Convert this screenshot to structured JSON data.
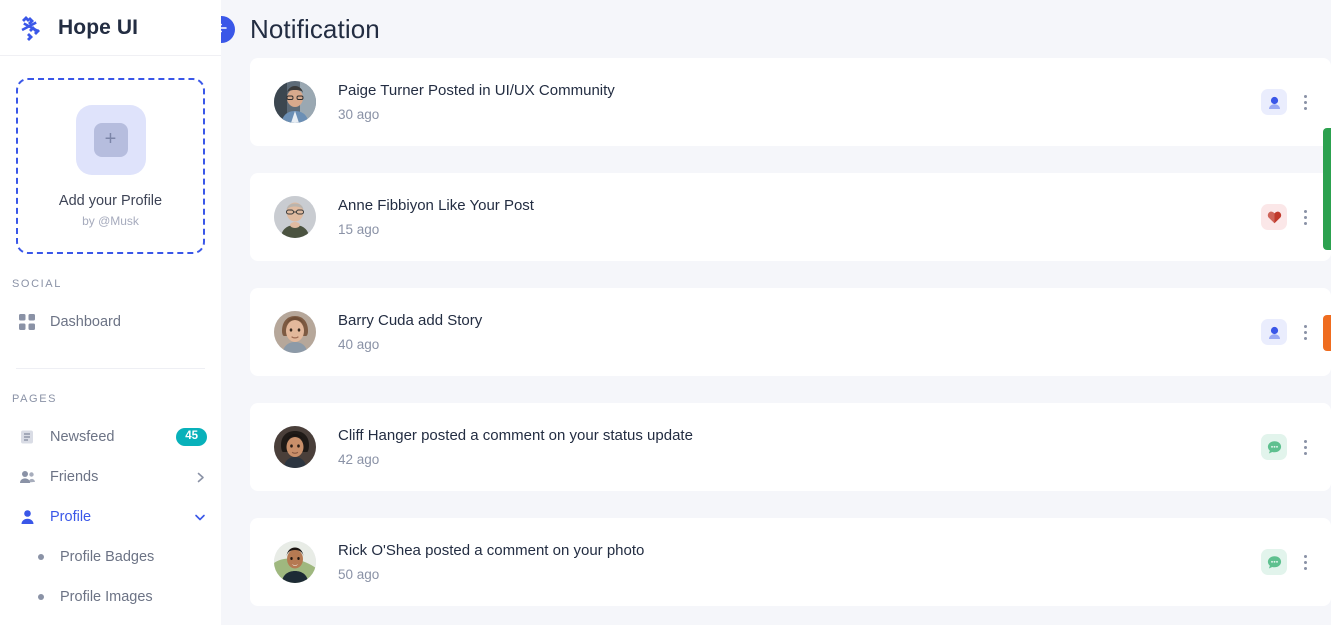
{
  "brand": {
    "name": "Hope UI",
    "logo_icon": "hope-ui-logo-icon"
  },
  "add_profile": {
    "plus_icon": "plus-icon",
    "title": "Add your Profile",
    "subtitle": "by @Musk"
  },
  "sidebar": {
    "sections": [
      {
        "label": "SOCIAL",
        "items": [
          {
            "label": "Dashboard",
            "icon": "grid-icon",
            "name": "sidebar-item-dashboard",
            "active": false,
            "badge": null,
            "chevron": null,
            "children": []
          }
        ]
      },
      {
        "label": "PAGES",
        "items": [
          {
            "label": "Newsfeed",
            "icon": "newsfeed-icon",
            "name": "sidebar-item-newsfeed",
            "active": false,
            "badge": "45",
            "chevron": null,
            "children": []
          },
          {
            "label": "Friends",
            "icon": "friends-icon",
            "name": "sidebar-item-friends",
            "active": false,
            "badge": null,
            "chevron": "chevron-right-icon",
            "children": []
          },
          {
            "label": "Profile",
            "icon": "user-icon",
            "name": "sidebar-item-profile",
            "active": true,
            "badge": null,
            "chevron": "chevron-down-icon",
            "children": [
              {
                "label": "Profile Badges",
                "name": "sidebar-subitem-profile-badges"
              },
              {
                "label": "Profile Images",
                "name": "sidebar-subitem-profile-images"
              }
            ]
          }
        ]
      }
    ]
  },
  "header": {
    "title": "Notification",
    "back_icon": "arrow-left-icon"
  },
  "notifications": [
    {
      "text": "Paige Turner Posted in UI/UX Community",
      "time": "30 ago",
      "avatar": "avatar-paige-turner",
      "action_icon": "user-badge-icon",
      "action_style": "blue",
      "menu_icon": "kebab-menu-icon"
    },
    {
      "text": "Anne Fibbiyon Like Your Post",
      "time": "15 ago",
      "avatar": "avatar-anne-fibbiyon",
      "action_icon": "heart-icon",
      "action_style": "pink",
      "menu_icon": "kebab-menu-icon"
    },
    {
      "text": "Barry Cuda add Story",
      "time": "40 ago",
      "avatar": "avatar-barry-cuda",
      "action_icon": "user-badge-icon",
      "action_style": "blue",
      "menu_icon": "kebab-menu-icon"
    },
    {
      "text": "Cliff Hanger posted a comment on your status update",
      "time": "42 ago",
      "avatar": "avatar-cliff-hanger",
      "action_icon": "chat-bubble-icon",
      "action_style": "green",
      "menu_icon": "kebab-menu-icon"
    },
    {
      "text": "Rick O'Shea posted a comment on your photo",
      "time": "50 ago",
      "avatar": "avatar-rick-oshea",
      "action_icon": "chat-bubble-icon",
      "action_style": "green",
      "menu_icon": "kebab-menu-icon"
    }
  ],
  "edge_panels": [
    {
      "name": "edge-panel-green",
      "color": "#2ca14f"
    },
    {
      "name": "edge-panel-orange",
      "color": "#ef6c1f"
    }
  ],
  "colors": {
    "accent": "#3a57e8",
    "badge_teal": "#08b1ba",
    "text_primary": "#232d42",
    "text_muted": "#8a92a6",
    "page_bg": "#f5f6fa",
    "card_bg": "#ffffff"
  }
}
